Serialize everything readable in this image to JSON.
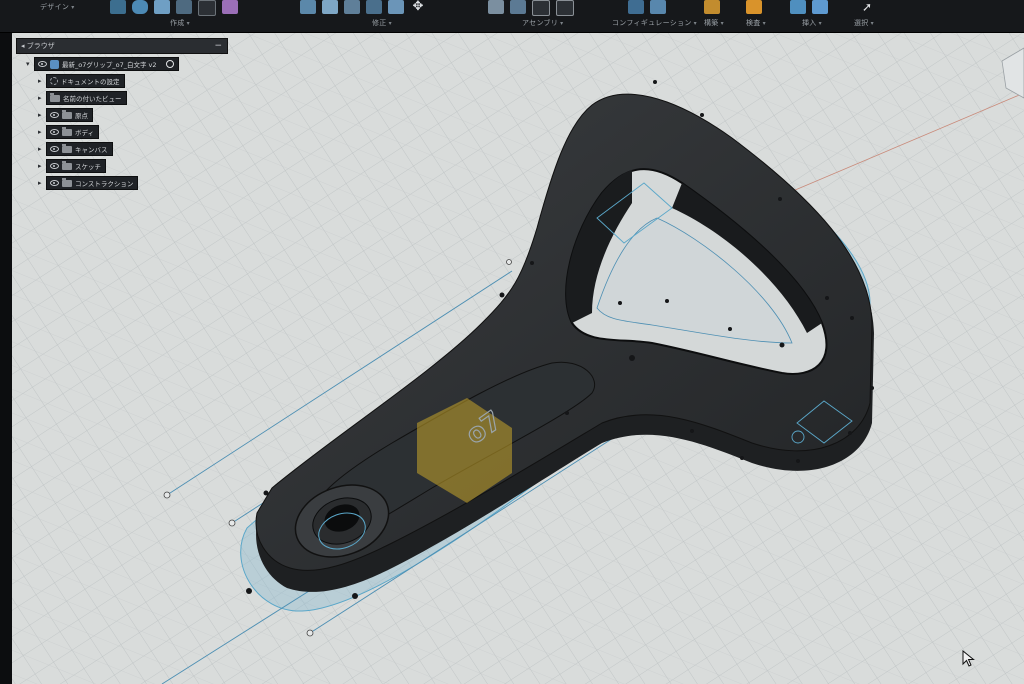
{
  "toolbar": {
    "groups": [
      {
        "id": "design",
        "label": "デザイン",
        "chevron": "▾"
      },
      {
        "id": "create",
        "label": "作成",
        "chevron": "▾"
      },
      {
        "id": "modify",
        "label": "修正",
        "chevron": "▾"
      },
      {
        "id": "assemble",
        "label": "アセンブリ",
        "chevron": "▾"
      },
      {
        "id": "configure",
        "label": "コンフィギュレーション",
        "chevron": "▾"
      },
      {
        "id": "construct",
        "label": "構築",
        "chevron": "▾"
      },
      {
        "id": "inspect",
        "label": "検査",
        "chevron": "▾"
      },
      {
        "id": "insert",
        "label": "挿入",
        "chevron": "▾"
      },
      {
        "id": "select",
        "label": "選択",
        "chevron": "▾"
      }
    ]
  },
  "browser": {
    "title": "ブラウザ",
    "collapse_icon": "−",
    "root": "最新_o7グリップ_o7_白文字 v2",
    "items": [
      {
        "label": "ドキュメントの設定",
        "icon": "gear-icon"
      },
      {
        "label": "名前の付いたビュー",
        "icon": "folder-icon"
      },
      {
        "label": "原点",
        "icon": "folder-icon"
      },
      {
        "label": "ボディ",
        "icon": "folder-icon"
      },
      {
        "label": "キャンバス",
        "icon": "folder-icon"
      },
      {
        "label": "スケッチ",
        "icon": "folder-icon"
      },
      {
        "label": "コンストラクション",
        "icon": "folder-icon"
      }
    ]
  },
  "model": {
    "engraved_text": "o7",
    "body_color": "#2b2d2f",
    "sketch_color": "#5aa7c9",
    "profile_color": "#c9a52a"
  },
  "colors": {
    "grid_bg": "#d9dcdb",
    "grid_line": "#bcc1c2",
    "toolbar_bg": "#16181b"
  }
}
